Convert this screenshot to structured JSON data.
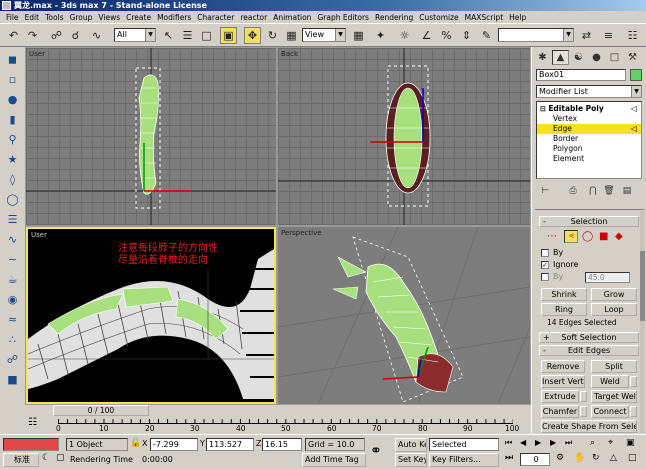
{
  "window": {
    "title": "翼龙.max - 3ds max 7 - Stand-alone License"
  },
  "menu": [
    "File",
    "Edit",
    "Tools",
    "Group",
    "Views",
    "Create",
    "Modifiers",
    "Character",
    "reactor",
    "Animation",
    "Graph Editors",
    "Rendering",
    "Customize",
    "MAXScript",
    "Help"
  ],
  "toolbar": {
    "selection_filter": "All",
    "reference_coord": "View"
  },
  "viewports": {
    "top_left": {
      "label": "User"
    },
    "top_right": {
      "label": "Back"
    },
    "bottom_left": {
      "label": "User",
      "annotation_line1": "注意每段脖子的方向性",
      "annotation_line2": "尽量沿着脊椎的走向"
    },
    "bottom_right": {
      "label": "Perspective"
    }
  },
  "timeline": {
    "slider_label": "0 / 100",
    "ticks": [
      "0",
      "10",
      "20",
      "30",
      "40",
      "50",
      "60",
      "70",
      "80",
      "90",
      "100"
    ]
  },
  "status": {
    "selection_count": "1 Object",
    "x_label": "X",
    "x_value": "-7.299",
    "y_label": "Y",
    "y_value": "113.527",
    "z_label": "Z",
    "z_value": "16.15",
    "grid": "Grid = 10.0",
    "auto_key": "Auto Key",
    "selected_set": "Selected",
    "set_key": "Set Key",
    "key_filters": "Key Filters...",
    "rendering_time_label": "Rendering Time",
    "rendering_time_value": "0:00:00",
    "add_time_tag": "Add Time Tag",
    "frame_value": "0",
    "mode_label": "标准"
  },
  "command_panel": {
    "object_name": "Box01",
    "object_color": "#5fd35f",
    "modifier_list": "Modifier List",
    "stack": [
      {
        "label": "Editable Poly",
        "level": "parent",
        "selected": false
      },
      {
        "label": "Vertex",
        "level": "child",
        "selected": false
      },
      {
        "label": "Edge",
        "level": "child",
        "selected": true
      },
      {
        "label": "Border",
        "level": "child",
        "selected": false
      },
      {
        "label": "Polygon",
        "level": "child",
        "selected": false
      },
      {
        "label": "Element",
        "level": "child",
        "selected": false
      }
    ],
    "selection_rollout": {
      "title": "Selection",
      "by_label": "By",
      "ignore_label": "Ignore",
      "by_angle_label": "By",
      "angle_value": "45.0",
      "shrink": "Shrink",
      "grow": "Grow",
      "ring": "Ring",
      "loop": "Loop",
      "info": "14 Edges Selected"
    },
    "soft_selection": {
      "title": "Soft Selection"
    },
    "edit_edges": {
      "title": "Edit Edges",
      "remove": "Remove",
      "split": "Split",
      "insert_vertex": "Insert Vertex",
      "weld": "Weld",
      "extrude": "Extrude",
      "target_weld": "Target Weld",
      "chamfer": "Chamfer",
      "connect": "Connect",
      "create_shape": "Create Shape From Selection"
    }
  },
  "colors": {
    "accent_yellow": "#f5e21a",
    "title_blue": "#0a246a"
  }
}
